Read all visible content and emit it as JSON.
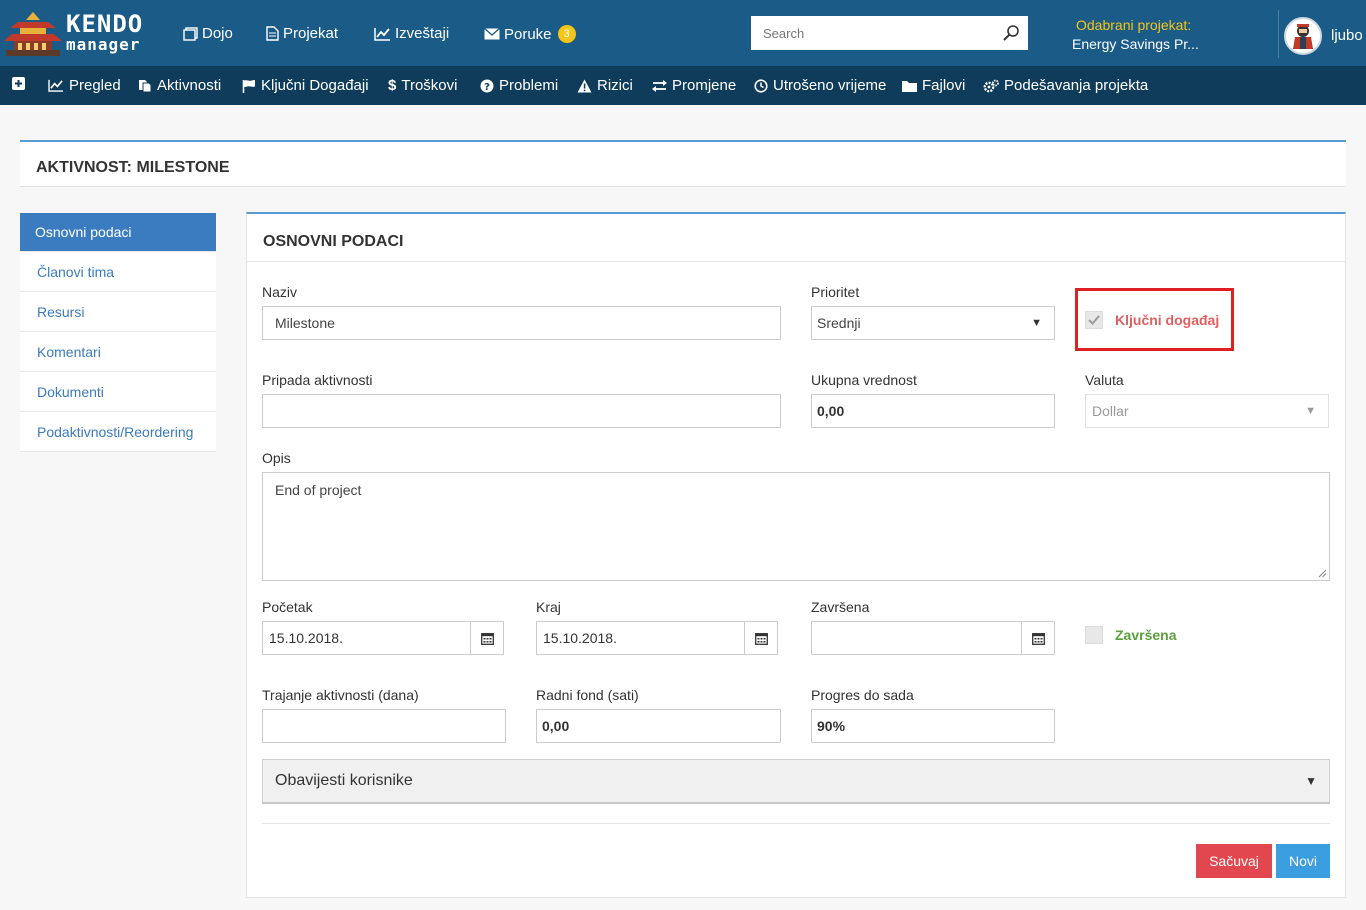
{
  "brand": {
    "line1": "KENDO",
    "line2": "manager"
  },
  "topnav": [
    {
      "label": "Dojo",
      "icon": "dojo-icon"
    },
    {
      "label": "Projekat",
      "icon": "document-icon"
    },
    {
      "label": "Izveštaji",
      "icon": "chart-icon"
    },
    {
      "label": "Poruke",
      "icon": "envelope-icon",
      "badge": "3"
    }
  ],
  "search": {
    "placeholder": "Search"
  },
  "selected_project": {
    "label": "Odabrani projekat:",
    "name": "Energy Savings Pr..."
  },
  "user": {
    "name": "ljubo"
  },
  "subnav": [
    {
      "label": "",
      "icon": "plus-square-icon"
    },
    {
      "label": "Pregled",
      "icon": "chart-icon"
    },
    {
      "label": "Aktivnosti",
      "icon": "copy-icon"
    },
    {
      "label": "Ključni Događaji",
      "icon": "flag-icon"
    },
    {
      "label": "Troškovi",
      "icon": "dollar-icon"
    },
    {
      "label": "Problemi",
      "icon": "question-circle-icon"
    },
    {
      "label": "Rizici",
      "icon": "warning-icon"
    },
    {
      "label": "Promjene",
      "icon": "exchange-icon"
    },
    {
      "label": "Utrošeno vrijeme",
      "icon": "clock-icon"
    },
    {
      "label": "Fajlovi",
      "icon": "folder-icon"
    },
    {
      "label": "Podešavanja projekta",
      "icon": "gears-icon"
    }
  ],
  "page_title": "AKTIVNOST: MILESTONE",
  "sidemenu": [
    {
      "label": "Osnovni podaci",
      "active": true
    },
    {
      "label": "Članovi tima"
    },
    {
      "label": "Resursi"
    },
    {
      "label": "Komentari"
    },
    {
      "label": "Dokumenti"
    },
    {
      "label": "Podaktivnosti/Reordering"
    }
  ],
  "form": {
    "title": "OSNOVNI PODACI",
    "naziv": {
      "label": "Naziv",
      "value": "Milestone"
    },
    "prioritet": {
      "label": "Prioritet",
      "value": "Srednji"
    },
    "kljucni": {
      "label": "Ključni događaj",
      "checked": true
    },
    "pripada": {
      "label": "Pripada aktivnosti",
      "value": ""
    },
    "ukupna": {
      "label": "Ukupna vrednost",
      "value": "0,00"
    },
    "valuta": {
      "label": "Valuta",
      "value": "Dollar"
    },
    "opis": {
      "label": "Opis",
      "value": "End of project"
    },
    "pocetak": {
      "label": "Početak",
      "value": "15.10.2018."
    },
    "kraj": {
      "label": "Kraj",
      "value": "15.10.2018."
    },
    "zavrsena_date": {
      "label": "Završena",
      "value": ""
    },
    "zavrsena_cb": {
      "label": "Završena",
      "checked": false
    },
    "trajanje": {
      "label": "Trajanje aktivnosti (dana)",
      "value": ""
    },
    "radni_fond": {
      "label": "Radni fond (sati)",
      "value": "0,00"
    },
    "progres": {
      "label": "Progres do sada",
      "value": "90%"
    },
    "obavijesti": {
      "label": "Obavijesti korisnike"
    }
  },
  "buttons": {
    "save": "Sačuvaj",
    "new": "Novi"
  },
  "colors": {
    "topbar": "#1a5b87",
    "subnav": "#0e3c5a",
    "accent": "#3b7cc0",
    "highlight": "#e01e25",
    "save": "#e2474f",
    "new": "#3b9ee0"
  }
}
